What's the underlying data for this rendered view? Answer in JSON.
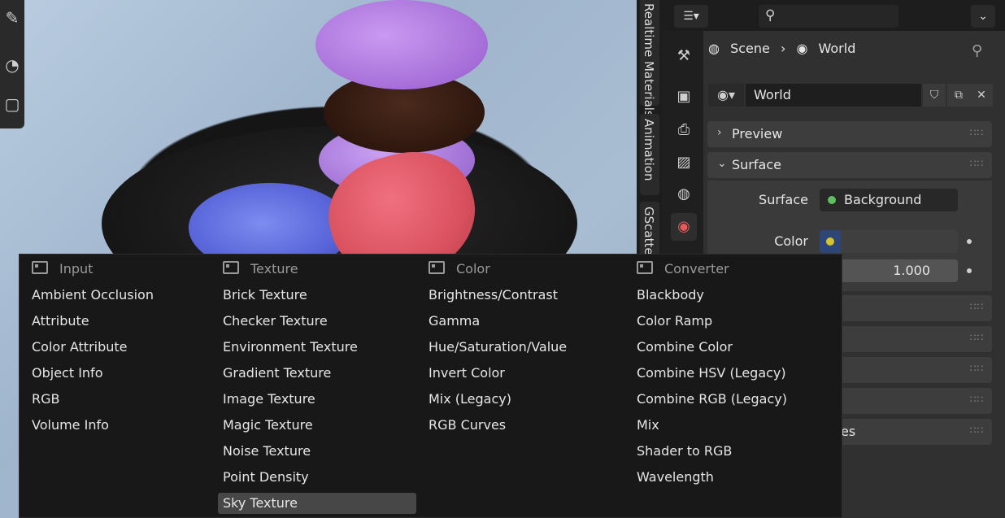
{
  "viewport": {
    "tools": [
      {
        "icon": "brush-icon"
      },
      {
        "icon": "ruler-icon"
      },
      {
        "icon": "add-cube-icon"
      }
    ]
  },
  "sidebar_tabs": [
    "Realtime Materials",
    "Animation",
    "GScatter"
  ],
  "properties": {
    "header": {
      "editor_type_icon": "editor-type-icon",
      "search_placeholder": "",
      "dropdown_icon": "chevron-down-icon"
    },
    "tabs": [
      {
        "name": "tool",
        "icon": "tool-icon",
        "active": false
      },
      {
        "name": "render",
        "icon": "render-icon",
        "active": false
      },
      {
        "name": "output",
        "icon": "output-icon",
        "active": false
      },
      {
        "name": "view-layer",
        "icon": "image-icon",
        "active": false
      },
      {
        "name": "scene",
        "icon": "scene-icon",
        "active": false
      },
      {
        "name": "world",
        "icon": "world-icon",
        "active": true
      }
    ],
    "breadcrumb": {
      "scene": "Scene",
      "separator": "›",
      "world": "World"
    },
    "world_selector": {
      "name": "World"
    },
    "panels": {
      "preview": "Preview",
      "surface": "Surface"
    },
    "surface": {
      "surface_label": "Surface",
      "surface_value": "Background",
      "surface_dot_color": "#5fbf5f",
      "color_label": "Color",
      "color_swatch": "#2e4677",
      "color_dot": "#d6c22c",
      "strength_value": "1.000"
    },
    "collapsed_panel_fragment": "es"
  },
  "add_menu": {
    "columns": [
      {
        "header": "Input",
        "items": [
          "Ambient Occlusion",
          "Attribute",
          "Color Attribute",
          "Object Info",
          "RGB",
          "Volume Info"
        ]
      },
      {
        "header": "Texture",
        "items": [
          "Brick Texture",
          "Checker Texture",
          "Environment Texture",
          "Gradient Texture",
          "Image Texture",
          "Magic Texture",
          "Noise Texture",
          "Point Density",
          "Sky Texture"
        ],
        "highlighted": "Sky Texture"
      },
      {
        "header": "Color",
        "items": [
          "Brightness/Contrast",
          "Gamma",
          "Hue/Saturation/Value",
          "Invert Color",
          "Mix (Legacy)",
          "RGB Curves"
        ]
      },
      {
        "header": "Converter",
        "items": [
          "Blackbody",
          "Color Ramp",
          "Combine Color",
          "Combine HSV (Legacy)",
          "Combine RGB (Legacy)",
          "Mix",
          "Shader to RGB",
          "Wavelength"
        ]
      }
    ]
  }
}
